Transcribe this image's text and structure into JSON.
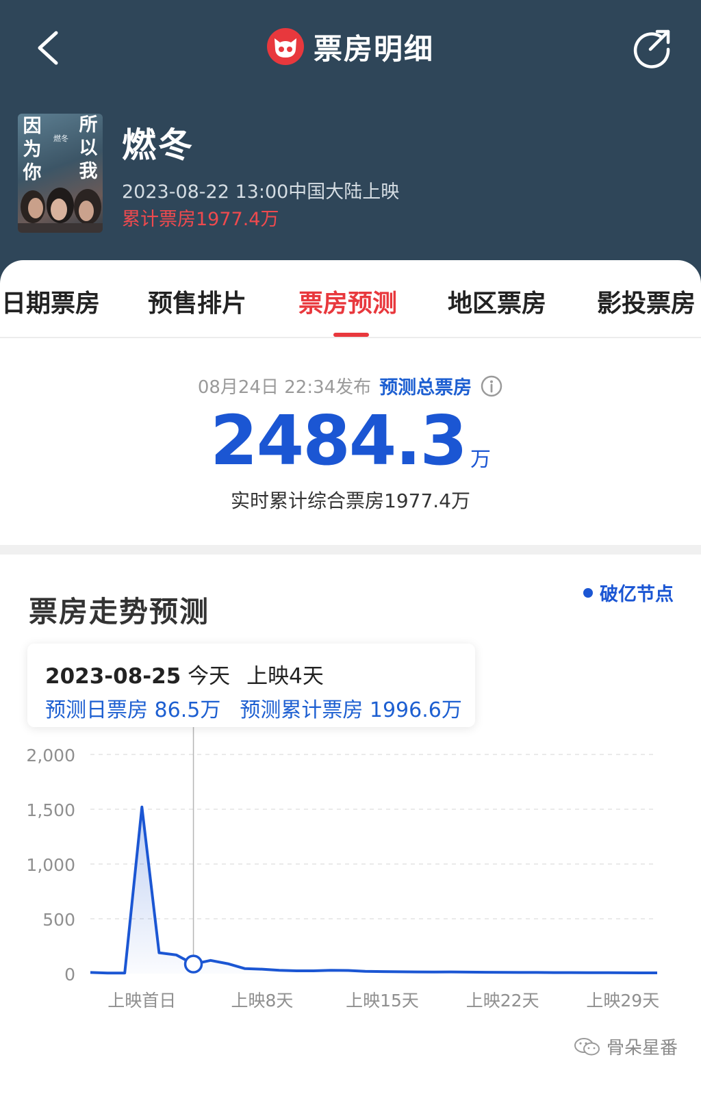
{
  "header": {
    "title": "票房明细",
    "bg_color": "#2f4659"
  },
  "movie": {
    "name": "燃冬",
    "release": "2023-08-22 13:00中国大陆上映",
    "cumulative": "累计票房1977.4万",
    "poster_text_left": "因为你",
    "poster_text_right": "所以我",
    "poster_small_title": "燃冬"
  },
  "tabs": [
    {
      "label": "日期票房"
    },
    {
      "label": "预售排片"
    },
    {
      "label": "票房预测",
      "active": true
    },
    {
      "label": "地区票房"
    },
    {
      "label": "影投票房"
    }
  ],
  "forecast": {
    "published": "08月24日  22:34发布",
    "label": "预测总票房",
    "value": "2484.3",
    "unit": "万",
    "realtime": "实时累计综合票房1977.4万"
  },
  "trend": {
    "title": "票房走势预测",
    "legend": "破亿节点",
    "tooltip": {
      "date": "2023-08-25",
      "today": "今天",
      "days": "上映4天",
      "daily": "预测日票房 86.5万",
      "total": "预测累计票房 1996.6万"
    }
  },
  "chart_data": {
    "type": "area",
    "y_ticks": [
      "2,000",
      "1,500",
      "1,000",
      "500",
      "0"
    ],
    "ylim": [
      0,
      2000
    ],
    "x_tick_labels": [
      "上映首日",
      "上映8天",
      "上映15天",
      "上映22天",
      "上映29天"
    ],
    "x_ticks": [
      1,
      8,
      15,
      22,
      29
    ],
    "xlim": [
      -2,
      31
    ],
    "series": [
      {
        "values": [
          [
            -2,
            10
          ],
          [
            -1,
            5
          ],
          [
            0,
            5
          ],
          [
            1,
            1520
          ],
          [
            2,
            190
          ],
          [
            3,
            170
          ],
          [
            4,
            86.5
          ],
          [
            5,
            120
          ],
          [
            6,
            90
          ],
          [
            7,
            45
          ],
          [
            8,
            40
          ],
          [
            9,
            30
          ],
          [
            10,
            25
          ],
          [
            11,
            25
          ],
          [
            12,
            30
          ],
          [
            13,
            28
          ],
          [
            14,
            20
          ],
          [
            15,
            18
          ],
          [
            16,
            16
          ],
          [
            17,
            15
          ],
          [
            18,
            14
          ],
          [
            19,
            15
          ],
          [
            20,
            13
          ],
          [
            21,
            12
          ],
          [
            22,
            11
          ],
          [
            23,
            10
          ],
          [
            24,
            10
          ],
          [
            25,
            9
          ],
          [
            26,
            9
          ],
          [
            27,
            8
          ],
          [
            28,
            8
          ],
          [
            29,
            7
          ],
          [
            30,
            6
          ],
          [
            31,
            6
          ]
        ]
      }
    ],
    "highlight_x": 4,
    "line_color": "#1b56d3",
    "grid": true
  },
  "watermark": "骨朵星番"
}
